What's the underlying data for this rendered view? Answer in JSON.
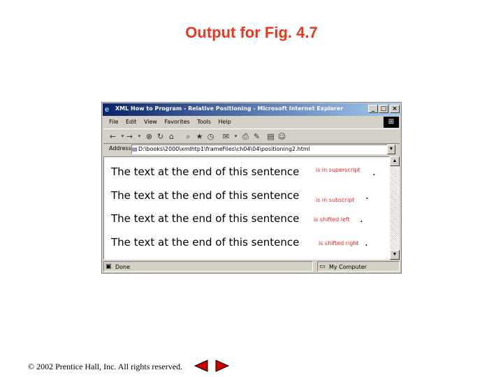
{
  "slide": {
    "title": "Output for Fig. 4.7",
    "footer": "© 2002 Prentice Hall, Inc.  All rights reserved."
  },
  "window": {
    "title": "XML How to Program - Relative Positioning - Microsoft Internet Explorer",
    "controls": {
      "minimize": "_",
      "maximize": "□",
      "close": "×"
    }
  },
  "menu": [
    "File",
    "Edit",
    "View",
    "Favorites",
    "Tools",
    "Help"
  ],
  "address": {
    "label": "Address",
    "value": "D:\\books\\2000\\xmlhtp1\\frameFiles\\ch04\\04\\positioning2.html"
  },
  "content": {
    "lines": [
      {
        "text": "The text at the end of this sentence",
        "span": "is in superscript",
        "trail": "."
      },
      {
        "text": "The text at the end of this sentence",
        "span": "is in subscript",
        "trail": "."
      },
      {
        "text": "The text at the end of this sentence",
        "span": "is shifted left",
        "trail": "."
      },
      {
        "text": "The text at the end of this sentence",
        "span": "is shifted right",
        "trail": "."
      }
    ]
  },
  "status": {
    "left": "Done",
    "right": "My Computer"
  },
  "icons": {
    "back": "back-arrow-icon",
    "forward": "forward-arrow-icon",
    "stop": "stop-icon",
    "refresh": "refresh-icon",
    "home": "home-icon",
    "search": "search-icon",
    "favorites": "favorites-icon",
    "history": "history-icon",
    "mail": "mail-icon",
    "print": "print-icon",
    "edit": "edit-icon",
    "discuss": "discuss-icon",
    "messenger": "messenger-icon"
  },
  "colors": {
    "slide_title": "#e8381f",
    "titlebar": "#0a246a",
    "span_text": "#e82020",
    "nav_arrow": "#cc0000"
  }
}
